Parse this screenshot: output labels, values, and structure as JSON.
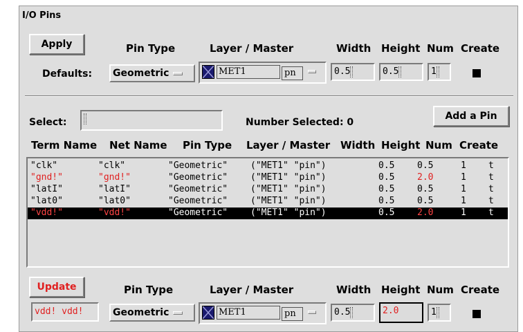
{
  "window": {
    "title": "I/O Pins"
  },
  "top": {
    "apply_label": "Apply",
    "defaults_label": "Defaults:",
    "headers": {
      "pin_type": "Pin Type",
      "layer_master": "Layer / Master",
      "width": "Width",
      "height": "Height",
      "num": "Num",
      "create": "Create"
    },
    "pin_type_value": "Geometric",
    "layer_value": "MET1",
    "purpose_value": "pn",
    "width_value": "0.5",
    "height_value": "0.5",
    "num_value": "1"
  },
  "select": {
    "label": "Select:",
    "value": "",
    "number_selected_label": "Number Selected: 0",
    "add_pin_label": "Add a Pin"
  },
  "table": {
    "headers": {
      "term": "Term Name",
      "net": "Net Name",
      "pin_type": "Pin Type",
      "layer_master": "Layer / Master",
      "width": "Width",
      "height": "Height",
      "num": "Num",
      "create": "Create"
    },
    "rows": [
      {
        "term": "\"clk\"",
        "net": "\"clk\"",
        "type": "\"Geometric\"",
        "layer": "(\"MET1\" \"pin\")",
        "width": "0.5",
        "height": "0.5",
        "num": "1",
        "create": "t"
      },
      {
        "term": "\"gnd!\"",
        "net": "\"gnd!\"",
        "type": "\"Geometric\"",
        "layer": "(\"MET1\" \"pin\")",
        "width": "0.5",
        "height": "2.0",
        "num": "1",
        "create": "t"
      },
      {
        "term": "\"latI\"",
        "net": "\"latI\"",
        "type": "\"Geometric\"",
        "layer": "(\"MET1\" \"pin\")",
        "width": "0.5",
        "height": "0.5",
        "num": "1",
        "create": "t"
      },
      {
        "term": "\"lat0\"",
        "net": "\"lat0\"",
        "type": "\"Geometric\"",
        "layer": "(\"MET1\" \"pin\")",
        "width": "0.5",
        "height": "0.5",
        "num": "1",
        "create": "t"
      },
      {
        "term": "\"vdd!\"",
        "net": "\"vdd!\"",
        "type": "\"Geometric\"",
        "layer": "(\"MET1\" \"pin\")",
        "width": "0.5",
        "height": "2.0",
        "num": "1",
        "create": "t"
      }
    ]
  },
  "bottom": {
    "update_label": "Update",
    "headers": {
      "pin_type": "Pin Type",
      "layer_master": "Layer / Master",
      "width": "Width",
      "height": "Height",
      "num": "Num",
      "create": "Create"
    },
    "selected_names": "vdd! vdd!",
    "pin_type_value": "Geometric",
    "layer_value": "MET1",
    "purpose_value": "pn",
    "width_value": "0.5",
    "height_value": "2.0",
    "num_value": "1"
  },
  "colors": {
    "modified": "#e02020",
    "panel": "#dedede",
    "selection": "#000000",
    "layer_swatch": "#1a1a6e"
  }
}
